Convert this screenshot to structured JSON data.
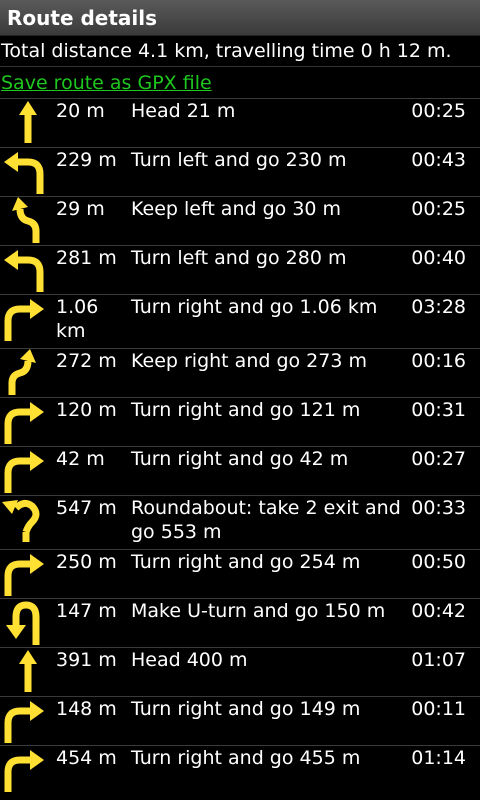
{
  "title": "Route details",
  "summary": "Total distance 4.1 km, travelling time 0 h 12 m.",
  "gpx_link": "Save route as GPX file",
  "steps": [
    {
      "icon": "straight-arrow-icon",
      "distance": "20 m",
      "instruction": "Head 21 m",
      "time": "00:25"
    },
    {
      "icon": "turn-left-icon",
      "distance": "229 m",
      "instruction": "Turn left and go 230 m",
      "time": "00:43"
    },
    {
      "icon": "keep-left-icon",
      "distance": "29 m",
      "instruction": "Keep left and go 30 m",
      "time": "00:25"
    },
    {
      "icon": "turn-left-icon",
      "distance": "281 m",
      "instruction": "Turn left and go 280 m",
      "time": "00:40"
    },
    {
      "icon": "turn-right-icon",
      "distance": "1.06 km",
      "instruction": "Turn right and go 1.06 km",
      "time": "03:28"
    },
    {
      "icon": "keep-right-icon",
      "distance": "272 m",
      "instruction": "Keep right and go 273 m",
      "time": "00:16"
    },
    {
      "icon": "turn-right-icon",
      "distance": "120 m",
      "instruction": "Turn right and go 121 m",
      "time": "00:31"
    },
    {
      "icon": "turn-right-icon",
      "distance": "42 m",
      "instruction": "Turn right and go 42 m",
      "time": "00:27"
    },
    {
      "icon": "roundabout-icon",
      "distance": "547 m",
      "instruction": "Roundabout: take 2 exit and go 553 m",
      "time": "00:33"
    },
    {
      "icon": "turn-right-icon",
      "distance": "250 m",
      "instruction": "Turn right and go 254 m",
      "time": "00:50"
    },
    {
      "icon": "u-turn-icon",
      "distance": "147 m",
      "instruction": "Make U-turn and go 150 m",
      "time": "00:42"
    },
    {
      "icon": "straight-arrow-icon",
      "distance": "391 m",
      "instruction": "Head 400 m",
      "time": "01:07"
    },
    {
      "icon": "turn-right-icon",
      "distance": "148 m",
      "instruction": "Turn right and go 149 m",
      "time": "00:11"
    },
    {
      "icon": "turn-right-icon",
      "distance": "454 m",
      "instruction": "Turn right and go 455 m",
      "time": "01:14"
    }
  ],
  "colors": {
    "arrow": "#ffe033",
    "link": "#1ec71e",
    "background": "#000000"
  }
}
